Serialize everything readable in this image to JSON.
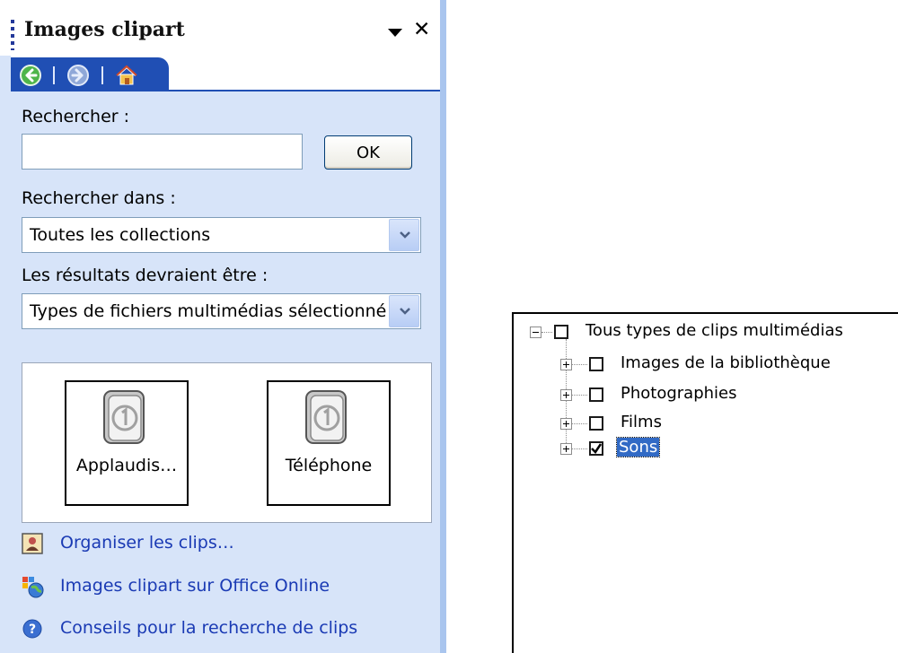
{
  "pane": {
    "title": "Images clipart",
    "search_label": "Rechercher :",
    "search_value": "",
    "ok_label": "OK",
    "search_in_label": "Rechercher dans :",
    "search_in_value": "Toutes les collections",
    "results_type_label": "Les résultats devraient être :",
    "results_type_value": "Types de fichiers multimédias sélectionné",
    "nav_icons": [
      "back-icon",
      "forward-icon",
      "home-icon"
    ],
    "results": [
      {
        "label": "Applaudis…",
        "icon": "sound-clip-icon"
      },
      {
        "label": "Téléphone",
        "icon": "sound-clip-icon"
      }
    ],
    "links": [
      {
        "label": "Organiser les clips…",
        "icon": "organizer-icon"
      },
      {
        "label": "Images clipart sur Office Online",
        "icon": "office-online-icon"
      },
      {
        "label": "Conseils pour la recherche de clips",
        "icon": "help-icon"
      }
    ]
  },
  "tree": {
    "root": {
      "label": "Tous types de clips multimédias",
      "checked": false,
      "expanded": true
    },
    "children": [
      {
        "label": "Images de la bibliothèque",
        "checked": false,
        "expanded": false
      },
      {
        "label": "Photographies",
        "checked": false,
        "expanded": false
      },
      {
        "label": "Films",
        "checked": false,
        "expanded": false
      },
      {
        "label": "Sons",
        "checked": true,
        "expanded": false,
        "selected": true
      }
    ]
  },
  "colors": {
    "pane_bg": "#d7e4f9",
    "nav_strip": "#204fb4",
    "link_text": "#1a3ab4",
    "selection": "#316ac5"
  }
}
